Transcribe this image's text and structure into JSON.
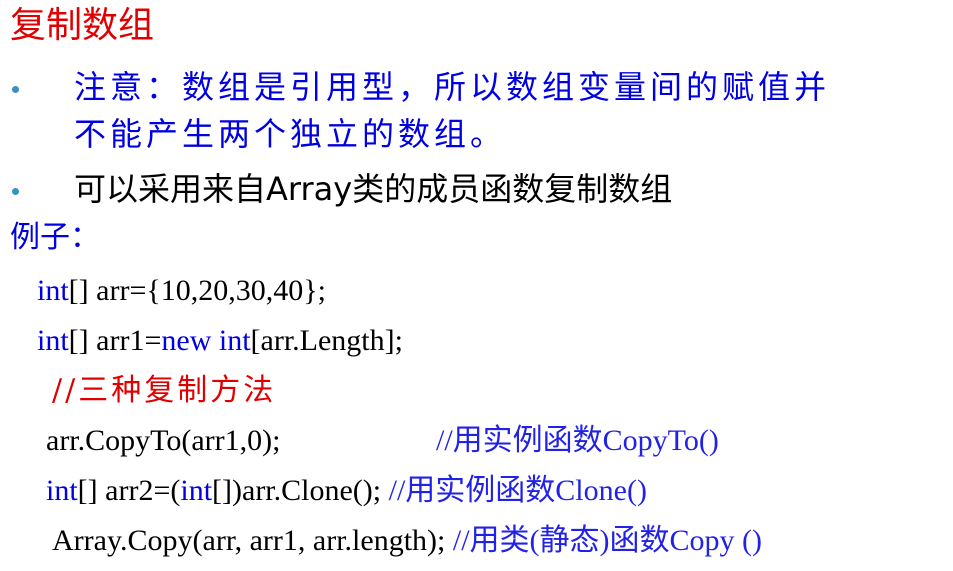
{
  "title": "复制数组",
  "bullets": [
    {
      "line1": "注意：数组是引用型，所以数组变量间的赋值并",
      "line2": "不能产生两个独立的数组。"
    },
    {
      "line1": "可以采用来自Array类的成员函数复制数组"
    }
  ],
  "example_label": "例子：",
  "code": {
    "l1": {
      "kw": "int",
      "rest": "[] arr={10,20,30,40};"
    },
    "l2": {
      "kw1": "int",
      "mid": "[] arr1=",
      "kw2": "new",
      "kw3": "int",
      "rest": "[arr.Length];"
    },
    "l3": {
      "comment": "//三种复制方法"
    },
    "l4": {
      "code": "arr.CopyTo(arr1,0);",
      "comment": "//用实例函数CopyTo()"
    },
    "l5": {
      "kw1": "int",
      "mid": "[] arr2=(",
      "kw2": "int",
      "rest": "[])arr.Clone(); ",
      "comment": "//用实例函数Clone()"
    },
    "l6": {
      "code": "Array.Copy(arr, arr1, arr.length); ",
      "comment": "//用类(静态)函数Copy ()"
    }
  },
  "colors": {
    "title": "#e00000",
    "keyword": "#0000e0",
    "comment_blue": "#2222e6",
    "comment_red": "#e00000",
    "bullet_dot": "#3a8fc4"
  }
}
